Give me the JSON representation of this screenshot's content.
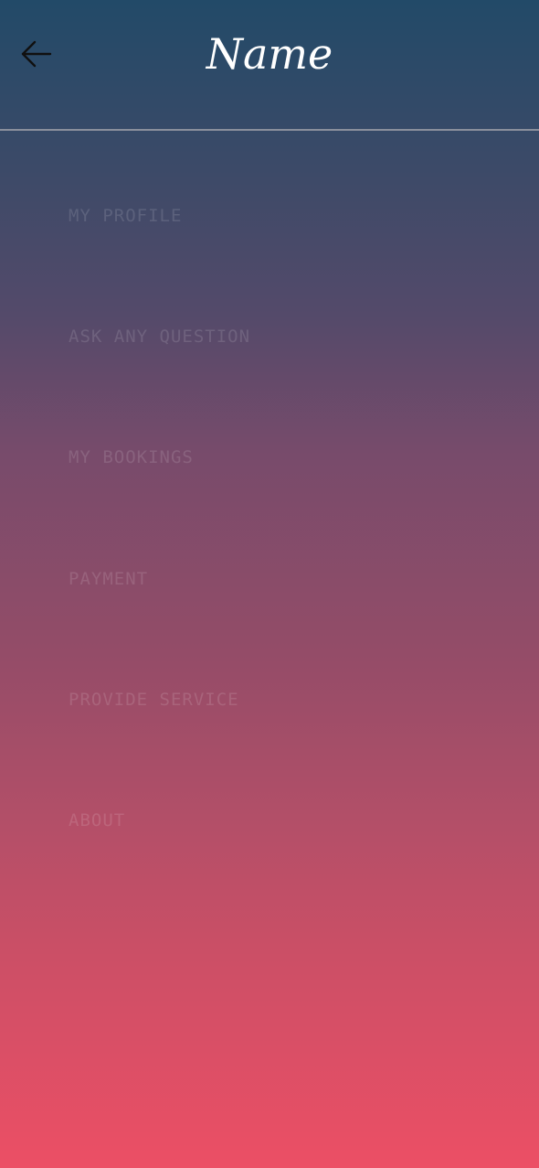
{
  "header": {
    "title": "Name",
    "back_icon": "arrow-left-icon"
  },
  "colors": {
    "gradient_top": "#224a68",
    "gradient_bottom": "#ec4f65",
    "title_text": "#ffffff",
    "menu_text": "rgba(255,255,255,0.13)"
  },
  "menu": {
    "items": [
      {
        "label": "MY PROFILE"
      },
      {
        "label": "ASK ANY QUESTION"
      },
      {
        "label": "MY BOOKINGS"
      },
      {
        "label": "PAYMENT"
      },
      {
        "label": "PROVIDE SERVICE"
      },
      {
        "label": "ABOUT"
      }
    ]
  }
}
